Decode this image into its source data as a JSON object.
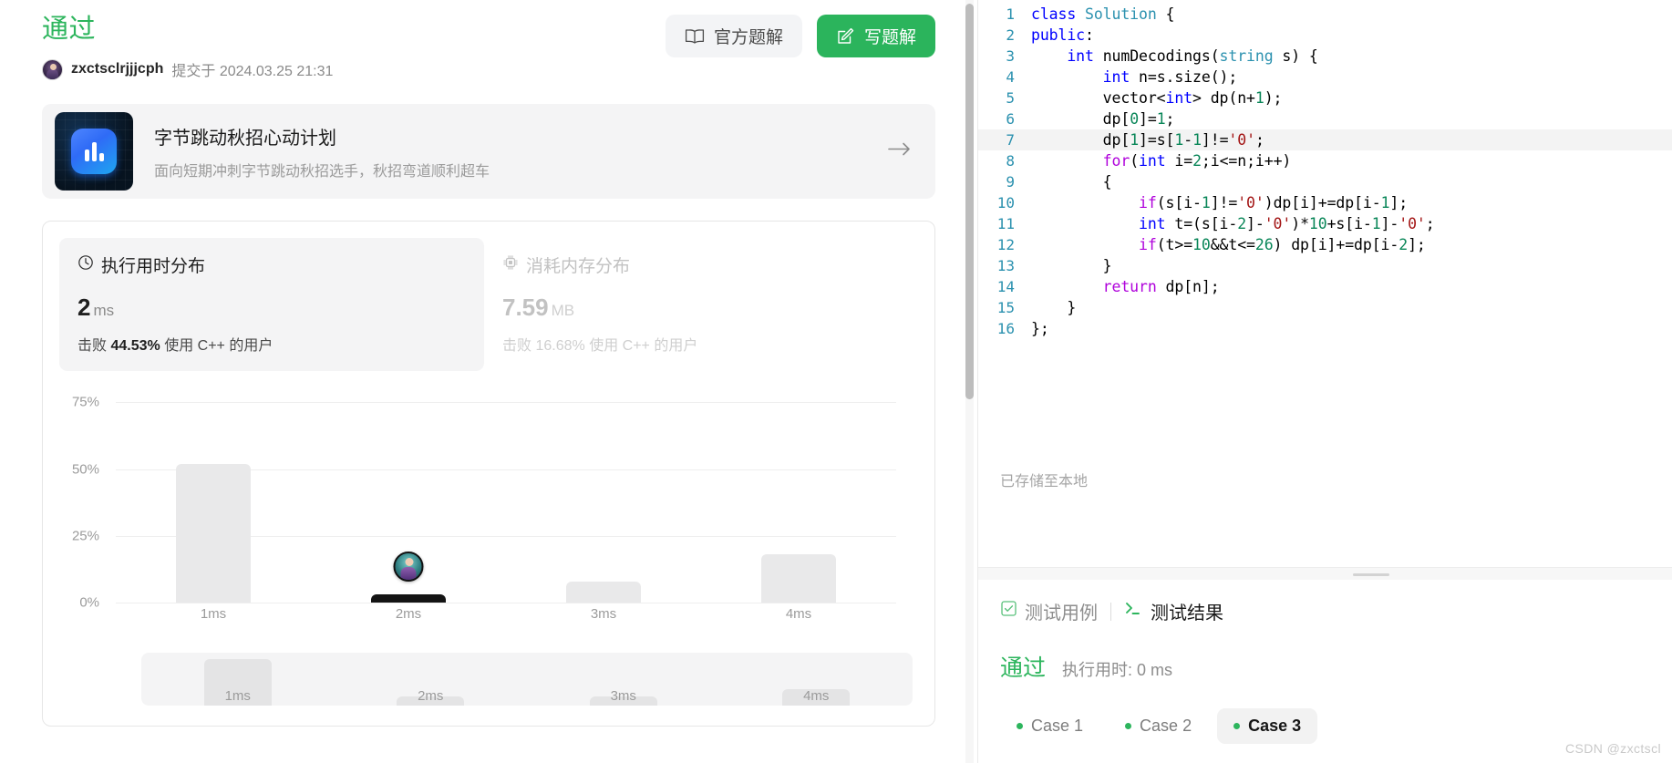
{
  "submission": {
    "verdict": "通过",
    "username": "zxctsclrjjjcph",
    "submitted_prefix": "提交于 2024.03.25 21:31"
  },
  "top_actions": {
    "official_solution": "官方题解",
    "write_solution": "写题解",
    "book_icon": "book-icon",
    "pencil_icon": "pencil-square-icon"
  },
  "promo": {
    "title": "字节跳动秋招心动计划",
    "subtitle": "面向短期冲刺字节跳动秋招选手，秋招弯道顺利超车",
    "arrow_icon": "arrow-right-icon",
    "logo_icon": "bar-chart-logo-icon"
  },
  "stats": {
    "runtime": {
      "icon": "clock-icon",
      "title": "执行用时分布",
      "value": "2",
      "unit": "ms",
      "beat_prefix": "击败",
      "beat_percent": "44.53%",
      "beat_suffix": "使用 C++ 的用户"
    },
    "memory": {
      "icon": "chip-icon",
      "title": "消耗内存分布",
      "value": "7.59",
      "unit": "MB",
      "beat_prefix": "击败",
      "beat_percent": "16.68%",
      "beat_suffix": "使用 C++ 的用户"
    }
  },
  "chart_data": {
    "type": "bar",
    "title": "执行用时分布",
    "xlabel": "",
    "ylabel": "",
    "categories": [
      "1ms",
      "2ms",
      "3ms",
      "4ms"
    ],
    "values": [
      52,
      3,
      8,
      18
    ],
    "highlight_index": 1,
    "highlight_color": "#141414",
    "bar_color": "#e9e9ea",
    "ytick_labels": [
      "75%",
      "50%",
      "25%",
      "0%"
    ],
    "ytick_values": [
      75,
      50,
      25,
      0
    ],
    "ylim": [
      0,
      82
    ],
    "grid": true,
    "legend": "none",
    "marker": {
      "category": "2ms",
      "type": "user-avatar"
    },
    "scrubber": {
      "categories": [
        "1ms",
        "2ms",
        "3ms",
        "4ms"
      ],
      "values": [
        52,
        3,
        8,
        18
      ]
    }
  },
  "editor": {
    "saved_note": "已存储至本地",
    "highlight_line": 7,
    "lines": [
      {
        "n": "1",
        "tokens": [
          {
            "t": "class ",
            "c": "k"
          },
          {
            "t": "Solution",
            "c": "ty"
          },
          {
            "t": " {",
            "c": ""
          }
        ]
      },
      {
        "n": "2",
        "tokens": [
          {
            "t": "public",
            "c": "k"
          },
          {
            "t": ":",
            "c": ""
          }
        ]
      },
      {
        "n": "3",
        "tokens": [
          {
            "t": "    ",
            "c": ""
          },
          {
            "t": "int",
            "c": "k"
          },
          {
            "t": " numDecodings(",
            "c": ""
          },
          {
            "t": "string",
            "c": "ty"
          },
          {
            "t": " s) {",
            "c": ""
          }
        ]
      },
      {
        "n": "4",
        "tokens": [
          {
            "t": "        ",
            "c": ""
          },
          {
            "t": "int",
            "c": "k"
          },
          {
            "t": " n=s.size();",
            "c": ""
          }
        ]
      },
      {
        "n": "5",
        "tokens": [
          {
            "t": "        vector<",
            "c": ""
          },
          {
            "t": "int",
            "c": "k"
          },
          {
            "t": "> dp(n+",
            "c": ""
          },
          {
            "t": "1",
            "c": "num"
          },
          {
            "t": ");",
            "c": ""
          }
        ]
      },
      {
        "n": "6",
        "tokens": [
          {
            "t": "        dp[",
            "c": ""
          },
          {
            "t": "0",
            "c": "num"
          },
          {
            "t": "]=",
            "c": ""
          },
          {
            "t": "1",
            "c": "num"
          },
          {
            "t": ";",
            "c": ""
          }
        ]
      },
      {
        "n": "7",
        "tokens": [
          {
            "t": "        dp[",
            "c": ""
          },
          {
            "t": "1",
            "c": "num"
          },
          {
            "t": "]=s[",
            "c": ""
          },
          {
            "t": "1",
            "c": "num"
          },
          {
            "t": "-",
            "c": ""
          },
          {
            "t": "1",
            "c": "num"
          },
          {
            "t": "]!=",
            "c": ""
          },
          {
            "t": "'0'",
            "c": "str"
          },
          {
            "t": ";",
            "c": ""
          }
        ]
      },
      {
        "n": "8",
        "tokens": [
          {
            "t": "        ",
            "c": ""
          },
          {
            "t": "for",
            "c": "kw-pink"
          },
          {
            "t": "(",
            "c": ""
          },
          {
            "t": "int",
            "c": "k"
          },
          {
            "t": " i=",
            "c": ""
          },
          {
            "t": "2",
            "c": "num"
          },
          {
            "t": ";i<=n;i++)",
            "c": ""
          }
        ]
      },
      {
        "n": "9",
        "tokens": [
          {
            "t": "        {",
            "c": ""
          }
        ]
      },
      {
        "n": "10",
        "tokens": [
          {
            "t": "            ",
            "c": ""
          },
          {
            "t": "if",
            "c": "kw-pink"
          },
          {
            "t": "(s[i-",
            "c": ""
          },
          {
            "t": "1",
            "c": "num"
          },
          {
            "t": "]!=",
            "c": ""
          },
          {
            "t": "'0'",
            "c": "str"
          },
          {
            "t": ")dp[i]+=dp[i-",
            "c": ""
          },
          {
            "t": "1",
            "c": "num"
          },
          {
            "t": "];",
            "c": ""
          }
        ]
      },
      {
        "n": "11",
        "tokens": [
          {
            "t": "            ",
            "c": ""
          },
          {
            "t": "int",
            "c": "k"
          },
          {
            "t": " t=(s[i-",
            "c": ""
          },
          {
            "t": "2",
            "c": "num"
          },
          {
            "t": "]-",
            "c": ""
          },
          {
            "t": "'0'",
            "c": "str"
          },
          {
            "t": ")*",
            "c": ""
          },
          {
            "t": "10",
            "c": "num"
          },
          {
            "t": "+s[i-",
            "c": ""
          },
          {
            "t": "1",
            "c": "num"
          },
          {
            "t": "]-",
            "c": ""
          },
          {
            "t": "'0'",
            "c": "str"
          },
          {
            "t": ";",
            "c": ""
          }
        ]
      },
      {
        "n": "12",
        "tokens": [
          {
            "t": "            ",
            "c": ""
          },
          {
            "t": "if",
            "c": "kw-pink"
          },
          {
            "t": "(t>=",
            "c": ""
          },
          {
            "t": "10",
            "c": "num"
          },
          {
            "t": "&&t<=",
            "c": ""
          },
          {
            "t": "26",
            "c": "num"
          },
          {
            "t": ") dp[i]+=dp[i-",
            "c": ""
          },
          {
            "t": "2",
            "c": "num"
          },
          {
            "t": "];",
            "c": ""
          }
        ]
      },
      {
        "n": "13",
        "tokens": [
          {
            "t": "        }",
            "c": ""
          }
        ]
      },
      {
        "n": "14",
        "tokens": [
          {
            "t": "        ",
            "c": ""
          },
          {
            "t": "return",
            "c": "kw-pink"
          },
          {
            "t": " dp[n];",
            "c": ""
          }
        ]
      },
      {
        "n": "15",
        "tokens": [
          {
            "t": "    }",
            "c": ""
          }
        ]
      },
      {
        "n": "16",
        "tokens": [
          {
            "t": "};",
            "c": ""
          }
        ]
      }
    ]
  },
  "results": {
    "tabs": [
      {
        "label": "测试用例",
        "icon": "check-square-icon",
        "active": false
      },
      {
        "label": "测试结果",
        "icon": "terminal-icon",
        "active": true
      }
    ],
    "status": "通过",
    "runtime_label": "执行用时: 0 ms",
    "cases": [
      {
        "label": "Case 1",
        "active": false
      },
      {
        "label": "Case 2",
        "active": false
      },
      {
        "label": "Case 3",
        "active": true
      }
    ]
  },
  "watermark": "CSDN @zxctscl",
  "colors": {
    "success": "#2db55d",
    "bar": "#e9e9ea",
    "bar_highlight": "#141414",
    "muted": "#9b9b9b"
  }
}
